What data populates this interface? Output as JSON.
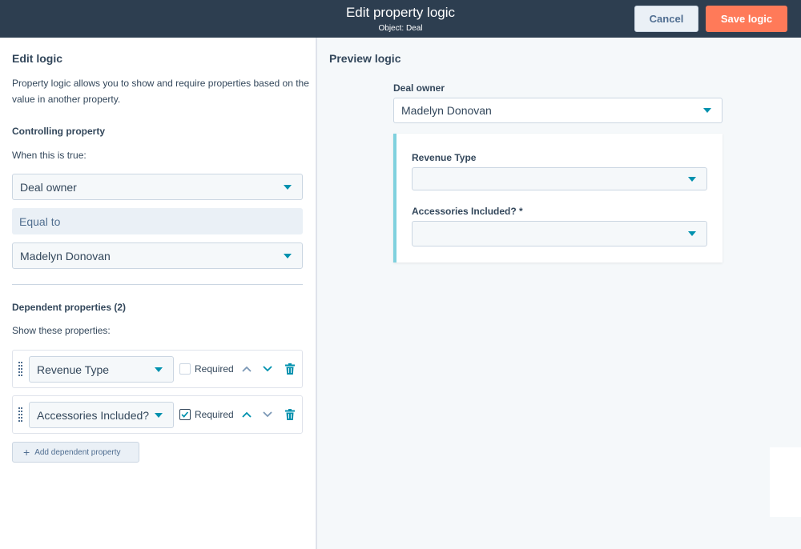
{
  "header": {
    "title": "Edit property logic",
    "subtitle": "Object: Deal",
    "cancel_label": "Cancel",
    "save_label": "Save logic"
  },
  "edit": {
    "heading": "Edit logic",
    "description": "Property logic allows you to show and require properties based on the value in another property.",
    "controlling_heading": "Controlling property",
    "when_text": "When this is true:",
    "property_value": "Deal owner",
    "operator_value": "Equal to",
    "match_value": "Madelyn Donovan",
    "dependent_heading": "Dependent properties (2)",
    "show_text": "Show these properties:",
    "dependents": [
      {
        "name": "Revenue Type",
        "required_label": "Required",
        "required": false
      },
      {
        "name": "Accessories Included?",
        "required_label": "Required",
        "required": true
      }
    ],
    "add_label": "Add dependent property"
  },
  "preview": {
    "heading": "Preview logic",
    "owner_label": "Deal owner",
    "owner_value": "Madelyn Donovan",
    "field1_label": "Revenue Type",
    "field1_value": "",
    "field2_label": "Accessories Included? *",
    "field2_value": ""
  },
  "colors": {
    "header_bg": "#2d3e50",
    "save_bg": "#ff7a59",
    "accent": "#0091ae",
    "card_border": "#7fd1de"
  }
}
